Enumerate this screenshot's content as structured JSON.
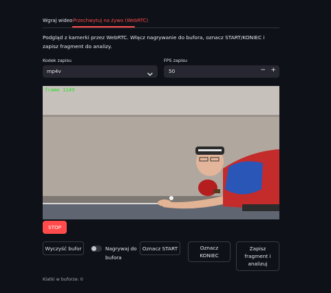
{
  "tabs": [
    {
      "label": "Wgraj wideo",
      "active": false
    },
    {
      "label": "Przechwytuj na żywo (WebRTC)",
      "active": true
    }
  ],
  "description": "Podgląd z kamerki przez WebRTC. Włącz nagrywanie do bufora, oznacz START/KONIEC i zapisz fragment do analizy.",
  "codec": {
    "label": "Kodek zapisu",
    "value": "mp4v"
  },
  "fps": {
    "label": "FPS zapisu",
    "value": "50",
    "minus": "−",
    "plus": "+"
  },
  "video": {
    "overlay_text": "frame 1149"
  },
  "stop_button": "STOP",
  "controls": {
    "clear": "Wyczyść bufor",
    "record_toggle": "Nagrywaj do bufora",
    "mark_start": "Oznacz START",
    "mark_end": "Oznacz KONIEC",
    "save": "Zapisz fragment i analizuj"
  },
  "buffer_status": "Klatki w buforze: 0",
  "colors": {
    "accent": "#ff4b4b",
    "background": "#0e1117",
    "input_bg": "#262730",
    "overlay_text": "#22e022"
  }
}
